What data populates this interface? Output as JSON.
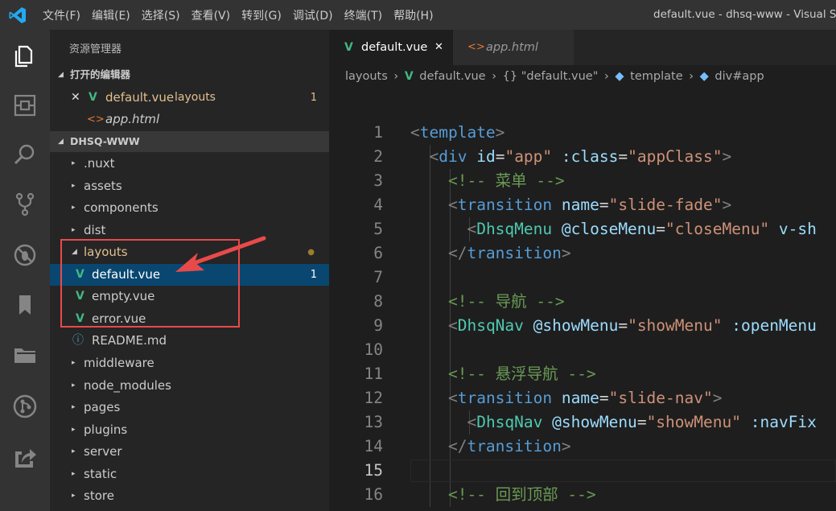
{
  "titlebar": {
    "menu": [
      "文件(F)",
      "编辑(E)",
      "选择(S)",
      "查看(V)",
      "转到(G)",
      "调试(D)",
      "终端(T)",
      "帮助(H)"
    ],
    "window_title": "default.vue - dhsq-www - Visual St"
  },
  "activity_bar": [
    "files-icon",
    "extensions-icon",
    "search-icon",
    "source-control-icon",
    "debug-icon",
    "bookmark-icon",
    "folder-icon",
    "git-graph-icon",
    "share-icon"
  ],
  "sidebar": {
    "title": "资源管理器",
    "open_editors": {
      "header": "打开的编辑器",
      "items": [
        {
          "name": "default.vue",
          "folder": "layouts",
          "badge": "1"
        },
        {
          "name": "app.html"
        }
      ]
    },
    "workspace": {
      "header": "DHSQ-WWW",
      "folders_before": [
        ".nuxt",
        "assets",
        "components",
        "dist"
      ],
      "layouts": {
        "name": "layouts",
        "files": [
          {
            "name": "default.vue",
            "badge": "1"
          },
          {
            "name": "empty.vue"
          },
          {
            "name": "error.vue"
          }
        ]
      },
      "readme": "README.md",
      "folders_after": [
        "middleware",
        "node_modules",
        "pages",
        "plugins",
        "server",
        "static",
        "store"
      ]
    }
  },
  "tabs": [
    {
      "name": "default.vue",
      "active": true
    },
    {
      "name": "app.html",
      "active": false
    }
  ],
  "breadcrumbs": {
    "folder": "layouts",
    "file": "default.vue",
    "obj": "{} \"default.vue\"",
    "template": "template",
    "div": "div#app"
  },
  "code": {
    "current_line": 15,
    "lines": [
      "<template>",
      "  <div id=\"app\" :class=\"appClass\">",
      "    <!-- 菜单 -->",
      "    <transition name=\"slide-fade\">",
      "      <DhsqMenu @closeMenu=\"closeMenu\" v-sh",
      "    </transition>",
      "",
      "    <!-- 导航 -->",
      "    <DhsqNav @showMenu=\"showMenu\" :openMenu",
      "",
      "    <!-- 悬浮导航 -->",
      "    <transition name=\"slide-nav\">",
      "      <DhsqNav @showMenu=\"showMenu\" :navFix",
      "    </transition>",
      "",
      "    <!-- 回到顶部 -->"
    ]
  },
  "colors": {
    "accent": "#41b883",
    "selection": "#094771",
    "annotation": "#e84a4a",
    "modified_dot": "#9a7d2c"
  }
}
